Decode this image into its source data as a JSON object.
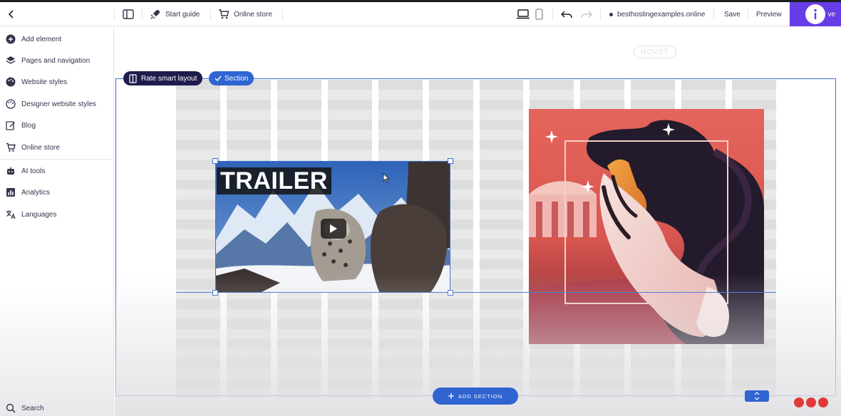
{
  "topbar": {
    "start_guide": "Start guide",
    "online_store": "Online store",
    "domain": "besthostingexamples.online",
    "save": "Save",
    "preview": "Preview",
    "publish_partial": "ve"
  },
  "sidebar": {
    "items": [
      {
        "label": "Add element",
        "icon": "plus-circle-icon"
      },
      {
        "label": "Pages and navigation",
        "icon": "layers-icon"
      },
      {
        "label": "Website styles",
        "icon": "palette-icon"
      },
      {
        "label": "Designer website styles",
        "icon": "palette-outline-icon"
      },
      {
        "label": "Blog",
        "icon": "edit-icon"
      },
      {
        "label": "Online store",
        "icon": "cart-icon"
      },
      {
        "label": "AI tools",
        "icon": "robot-icon"
      },
      {
        "label": "Analytics",
        "icon": "analytics-icon"
      },
      {
        "label": "Languages",
        "icon": "translate-icon"
      }
    ],
    "search": "Search"
  },
  "canvas": {
    "logo_ghost": "NOVST",
    "chip_layout": "Rate smart layout",
    "chip_section": "Section",
    "video_title": "TRAILER",
    "add_section": "ADD SECTION"
  },
  "colors": {
    "accent": "#673de6",
    "selection": "#3b6fd6",
    "chip_dark": "#1f1c4d",
    "record_dots": "#e23838"
  }
}
